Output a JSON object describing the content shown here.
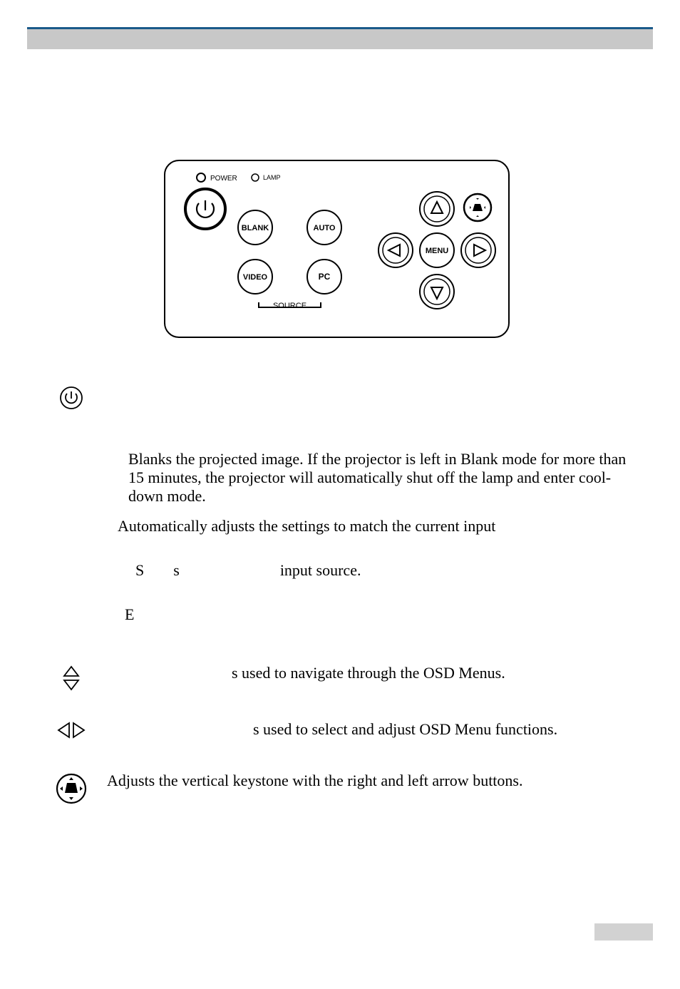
{
  "diagram": {
    "led_power": "POWER",
    "led_lamp": "LAMP",
    "btn_blank": "BLANK",
    "btn_auto": "AUTO",
    "btn_video": "VIDEO",
    "btn_pc": "PC",
    "btn_menu": "MENU",
    "source_label": "SOURCE"
  },
  "entries": {
    "blank_desc": "Blanks the projected image. If the projector is left in Blank mode for more than 15 minutes, the projector will automatically shut off the lamp and enter cool-down mode.",
    "auto_desc": "Automatically adjusts the settings to match the current input",
    "source_S": "S",
    "source_s": "s",
    "source_rest": "input source.",
    "menu_E": "E",
    "arrows_ud": "s  used to navigate through the OSD Menus.",
    "arrows_lr": "s  used to select and adjust OSD Menu functions.",
    "keystone_desc": "Adjusts the vertical keystone with the right and left arrow buttons."
  }
}
